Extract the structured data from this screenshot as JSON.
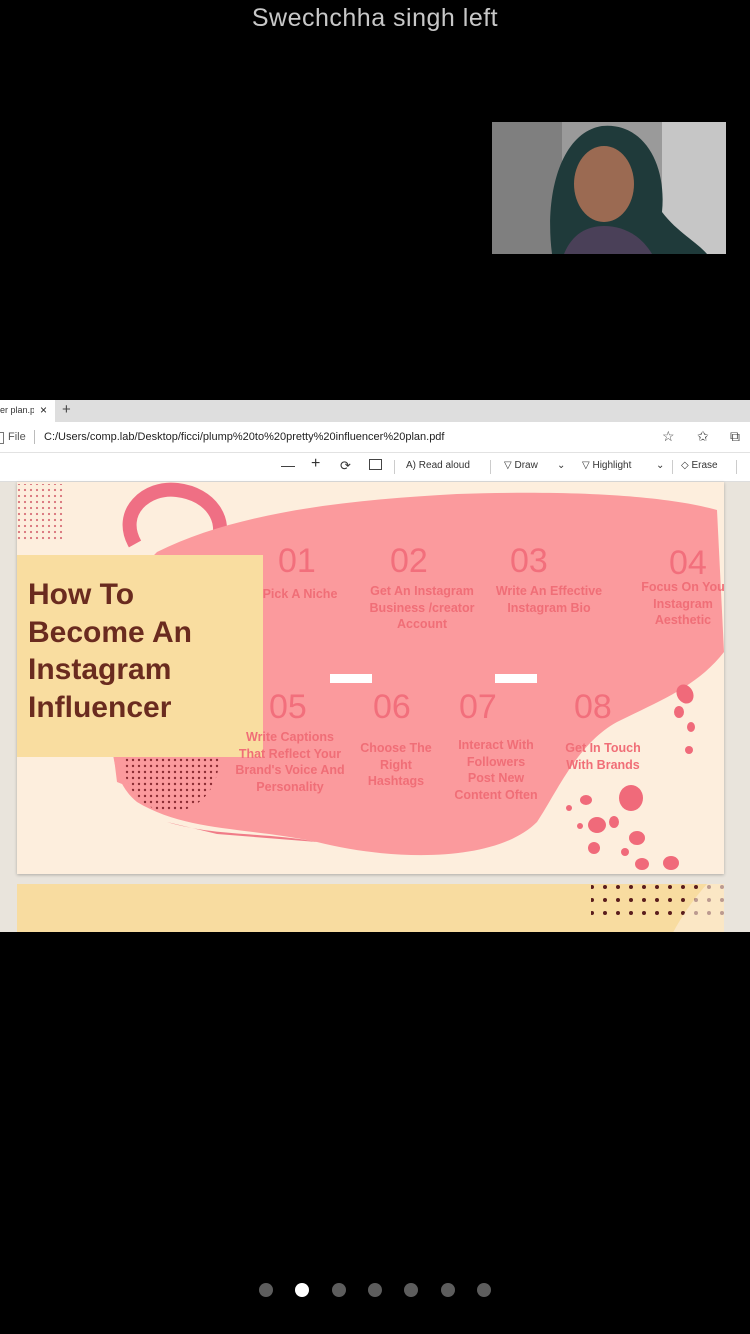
{
  "call": {
    "notice": "Swechchha singh left"
  },
  "browser": {
    "tab_title": "er plan.p",
    "tab_close": "×",
    "new_tab": "+",
    "file_label": "File",
    "url": "C:/Users/comp.lab/Desktop/ficci/plump%20to%20pretty%20influencer%20plan.pdf"
  },
  "pdf_toolbar": {
    "zoom_out": "—",
    "zoom_in": "+",
    "read_aloud": "Read aloud",
    "draw": "Draw",
    "highlight": "Highlight",
    "erase": "Erase"
  },
  "slide": {
    "title_lines": [
      "How To",
      "Become An",
      "Instagram",
      "Influencer"
    ],
    "steps": [
      {
        "num": "01",
        "label": "Pick A Niche"
      },
      {
        "num": "02",
        "label": "Get An Instagram\nBusiness /creator\nAccount"
      },
      {
        "num": "03",
        "label": "Write An Effective\nInstagram Bio"
      },
      {
        "num": "04",
        "label": "Focus On You\nInstagram\nAesthetic"
      },
      {
        "num": "05",
        "label": "Write Captions\nThat Reflect Your\nBrand's Voice And\nPersonality"
      },
      {
        "num": "06",
        "label": "Choose The\nRight\nHashtags"
      },
      {
        "num": "07",
        "label": "Interact With\nFollowers\nPost New\nContent Often"
      },
      {
        "num": "08",
        "label": "Get In Touch\nWith Brands"
      }
    ]
  },
  "pager": {
    "count": 7,
    "active_index": 1
  },
  "colors": {
    "background": "#000000",
    "slide_bg": "#fdeedd",
    "blob": "#fb9a9d",
    "title_box": "#f9dda0",
    "title_text": "#6a2b1f",
    "step_text": "#f06e77"
  }
}
